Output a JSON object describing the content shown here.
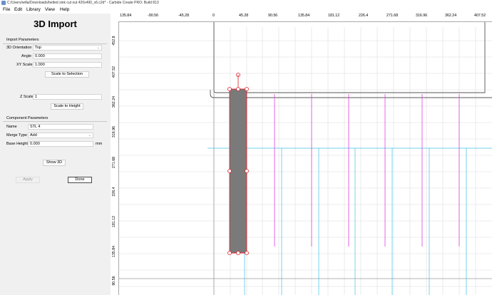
{
  "window": {
    "title": "C:/Users/willa/Downloads/belted sink cut out 420x490_v6.c2d* - Carbide Create PRO: Build 813"
  },
  "menu": [
    {
      "label": "File"
    },
    {
      "label": "Edit"
    },
    {
      "label": "Library"
    },
    {
      "label": "View"
    },
    {
      "label": "Help"
    }
  ],
  "panel": {
    "title": "3D Import",
    "import_params": {
      "header": "Import Parameters",
      "orientation_label": "3D Orientation",
      "orientation_value": "Top",
      "angle_label": "Angle",
      "angle_value": "0.000",
      "xy_scale_label": "XY Scale",
      "xy_scale_value": "1.000",
      "scale_to_selection": "Scale to Selection",
      "z_scale_label": "Z Scale",
      "z_scale_value": "1",
      "scale_to_height": "Scale to Height"
    },
    "component_params": {
      "header": "Component Parameters",
      "name_label": "Name",
      "name_value": "STL 4",
      "merge_label": "Merge Type",
      "merge_value": "Add",
      "base_height_label": "Base Height",
      "base_height_value": "0.000",
      "base_height_unit": "mm"
    },
    "show_3d": "Show 3D",
    "apply": "Apply",
    "done": "Done"
  },
  "ruler": {
    "horizontal": [
      "135.84",
      "-90.56",
      "-45.28",
      "0",
      "45.28",
      "90.56",
      "135.84",
      "181.12",
      "226.4",
      "271.68",
      "316.96",
      "362.24",
      "407.52"
    ],
    "vertical": [
      "452.8",
      "407.52",
      "362.24",
      "316.96",
      "271.68",
      "226.4",
      "181.12",
      "135.84",
      "90.56"
    ]
  },
  "colors": {
    "selection": "#e0202a",
    "toolpath_pink": "#e040e0",
    "toolpath_cyan": "#40c0e8",
    "grid": "#dcdcdc",
    "object_fill": "#7a7a7a"
  }
}
